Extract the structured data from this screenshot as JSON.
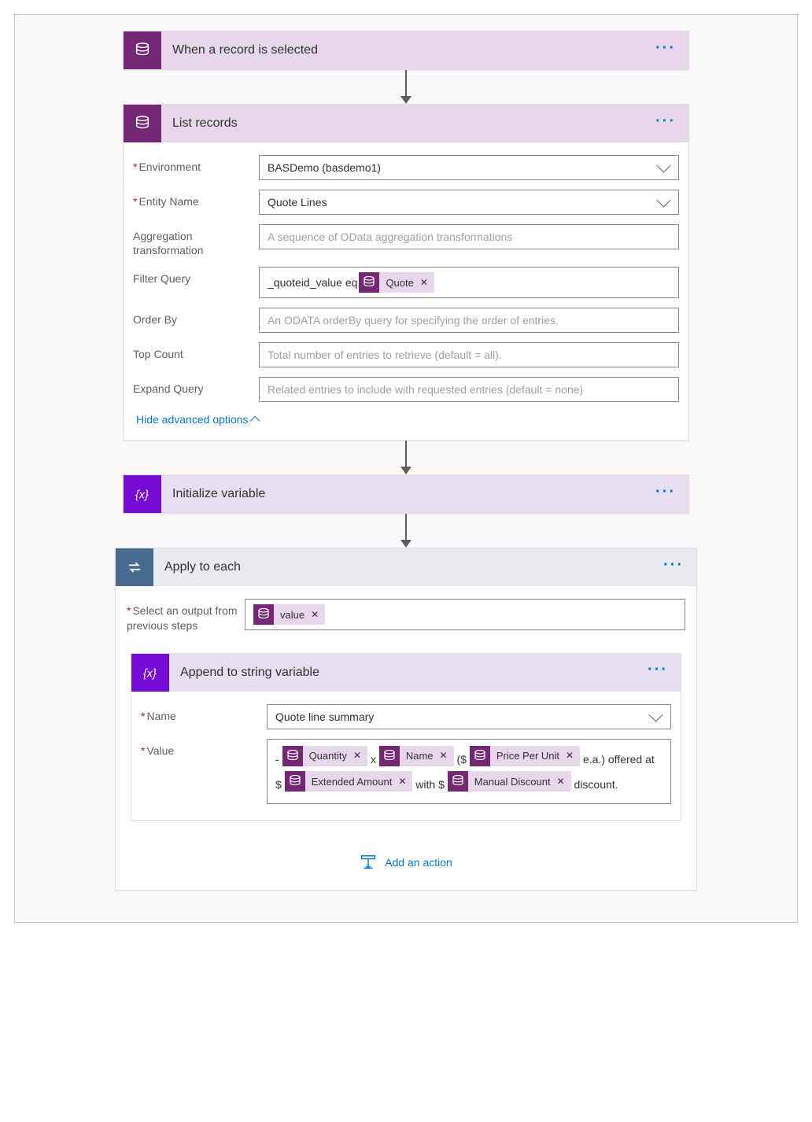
{
  "steps": {
    "trigger": {
      "title": "When a record is selected"
    },
    "list": {
      "title": "List records",
      "fields": {
        "environment": {
          "label": "Environment",
          "value": "BASDemo (basdemo1)"
        },
        "entity": {
          "label": "Entity Name",
          "value": "Quote Lines"
        },
        "agg": {
          "label": "Aggregation transformation",
          "placeholder": "A sequence of OData aggregation transformations"
        },
        "filter": {
          "label": "Filter Query",
          "prefix_text": "_quoteid_value eq",
          "token": "Quote"
        },
        "orderby": {
          "label": "Order By",
          "placeholder": "An ODATA orderBy query for specifying the order of entries."
        },
        "top": {
          "label": "Top Count",
          "placeholder": "Total number of entries to retrieve (default = all)."
        },
        "expand": {
          "label": "Expand Query",
          "placeholder": "Related entries to include with requested entries (default = none)"
        }
      },
      "adv_link": "Hide advanced options"
    },
    "initvar": {
      "title": "Initialize variable"
    },
    "loop": {
      "title": "Apply to each",
      "select_label": "Select an output from previous steps",
      "select_token": "value",
      "child": {
        "title": "Append to string variable",
        "name_label": "Name",
        "name_value": "Quote line summary",
        "value_label": "Value",
        "value_parts": {
          "t1": "-",
          "tok1": "Quantity",
          "t2": "x",
          "tok2": "Name",
          "t3": "($",
          "tok3": "Price Per Unit",
          "t4": "e.a.) offered at $",
          "tok4": "Extended Amount",
          "t5": "with $",
          "tok5": "Manual Discount",
          "t6": "discount."
        }
      },
      "add_action": "Add an action"
    }
  }
}
